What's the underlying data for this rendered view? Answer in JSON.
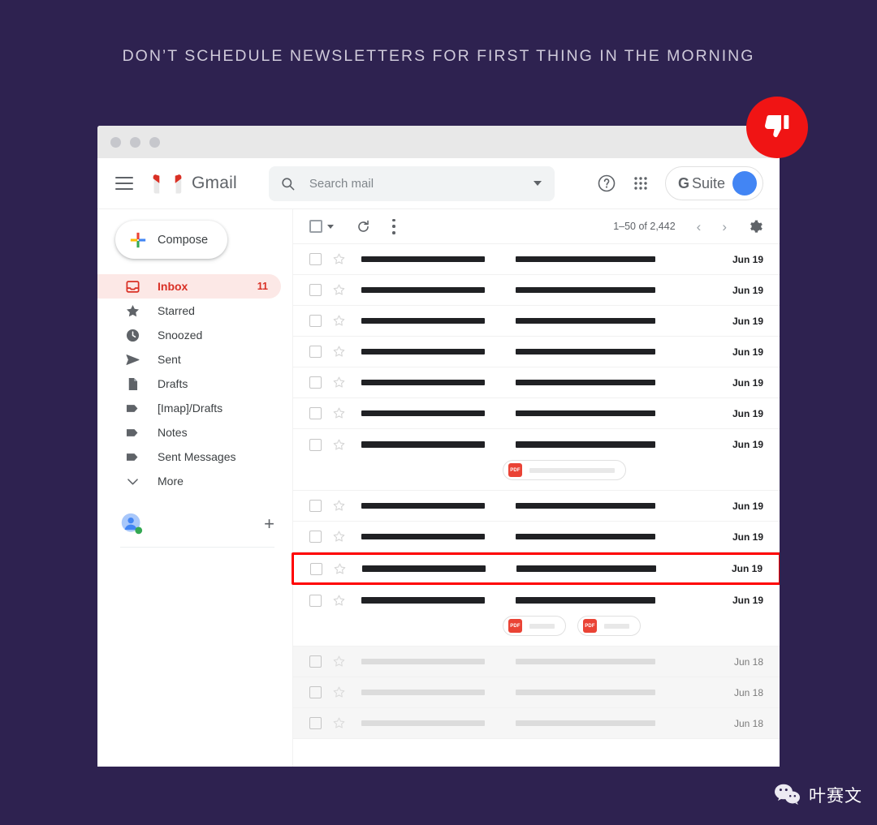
{
  "headline": "DON’T SCHEDULE NEWSLETTERS FOR FIRST THING IN THE MORNING",
  "colors": {
    "background": "#2e2250",
    "accent_red": "#f01414",
    "gmail_red": "#d93025",
    "inbox_pill": "#fce8e6",
    "avatar_blue": "#4285f4",
    "highlight_border": "#ff0000"
  },
  "badge": {
    "icon": "thumbs-down-icon"
  },
  "window": {
    "traffic_lights": [
      "close-dot",
      "minimize-dot",
      "maximize-dot"
    ]
  },
  "header": {
    "menu_icon": "hamburger-menu-icon",
    "logo_icon": "gmail-m-logo-icon",
    "brand": "Gmail",
    "search": {
      "icon": "search-icon",
      "placeholder": "Search mail",
      "value": "",
      "dropdown_icon": "chevron-down-icon"
    },
    "help_icon": "help-circle-icon",
    "apps_icon": "apps-grid-icon",
    "gsuite": {
      "g": "G",
      "label": "Suite",
      "avatar_icon": "user-avatar-icon"
    }
  },
  "sidebar": {
    "compose": {
      "label": "Compose",
      "icon": "plus-icon"
    },
    "items": [
      {
        "label": "Inbox",
        "icon": "inbox-icon",
        "count": "11",
        "active": true
      },
      {
        "label": "Starred",
        "icon": "star-icon",
        "count": "",
        "active": false
      },
      {
        "label": "Snoozed",
        "icon": "clock-icon",
        "count": "",
        "active": false
      },
      {
        "label": "Sent",
        "icon": "send-icon",
        "count": "",
        "active": false
      },
      {
        "label": "Drafts",
        "icon": "document-icon",
        "count": "",
        "active": false
      },
      {
        "label": "[Imap]/Drafts",
        "icon": "label-tag-icon",
        "count": "",
        "active": false
      },
      {
        "label": "Notes",
        "icon": "label-tag-icon",
        "count": "",
        "active": false
      },
      {
        "label": "Sent Messages",
        "icon": "label-tag-icon",
        "count": "",
        "active": false
      },
      {
        "label": "More",
        "icon": "chevron-down-icon",
        "count": "",
        "active": false
      }
    ],
    "contacts": {
      "avatar_icon": "contact-avatar-icon",
      "status": "online",
      "add_icon": "plus-icon"
    }
  },
  "toolbar": {
    "select_all_icon": "checkbox-icon",
    "select_caret_icon": "chevron-down-icon",
    "refresh_icon": "refresh-icon",
    "more_icon": "more-vertical-icon",
    "pagination": "1–50 of 2,442",
    "prev_icon": "chevron-left-icon",
    "next_icon": "chevron-right-icon",
    "settings_icon": "gear-icon"
  },
  "mail_rows": [
    {
      "date": "Jun 19",
      "read": false,
      "highlight": false,
      "attachments": []
    },
    {
      "date": "Jun 19",
      "read": false,
      "highlight": false,
      "attachments": []
    },
    {
      "date": "Jun 19",
      "read": false,
      "highlight": false,
      "attachments": []
    },
    {
      "date": "Jun 19",
      "read": false,
      "highlight": false,
      "attachments": []
    },
    {
      "date": "Jun 19",
      "read": false,
      "highlight": false,
      "attachments": []
    },
    {
      "date": "Jun 19",
      "read": false,
      "highlight": false,
      "attachments": []
    },
    {
      "date": "Jun 19",
      "read": false,
      "highlight": false,
      "attachments": [
        {
          "type": "PDF",
          "size": "wide"
        }
      ]
    },
    {
      "date": "Jun 19",
      "read": false,
      "highlight": false,
      "attachments": []
    },
    {
      "date": "Jun 19",
      "read": false,
      "highlight": false,
      "attachments": []
    },
    {
      "date": "Jun 19",
      "read": false,
      "highlight": true,
      "attachments": []
    },
    {
      "date": "Jun 19",
      "read": false,
      "highlight": false,
      "attachments": [
        {
          "type": "PDF",
          "size": "narrow"
        },
        {
          "type": "PDF",
          "size": "narrow"
        }
      ]
    },
    {
      "date": "Jun 18",
      "read": true,
      "highlight": false,
      "attachments": []
    },
    {
      "date": "Jun 18",
      "read": true,
      "highlight": false,
      "attachments": []
    },
    {
      "date": "Jun 18",
      "read": true,
      "highlight": false,
      "attachments": []
    }
  ],
  "watermark": {
    "icon": "wechat-icon",
    "text": "叶赛文"
  }
}
